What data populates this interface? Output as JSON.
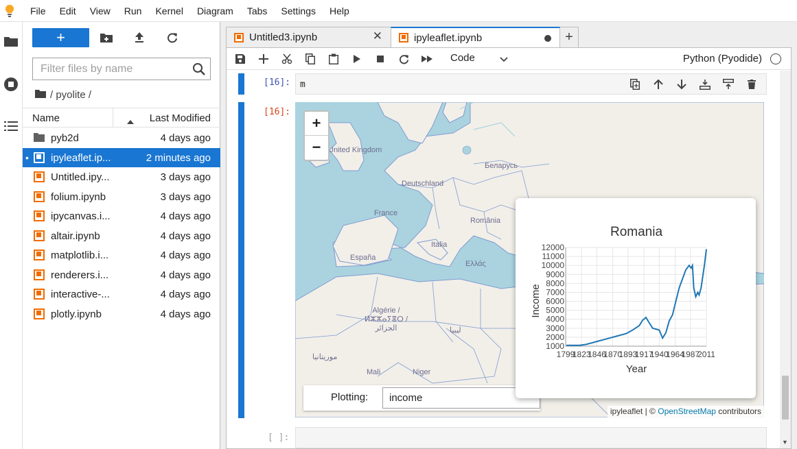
{
  "menu": [
    "File",
    "Edit",
    "View",
    "Run",
    "Kernel",
    "Diagram",
    "Tabs",
    "Settings",
    "Help"
  ],
  "filebrowser": {
    "new_label": "+",
    "filter_placeholder": "Filter files by name",
    "breadcrumb": "/ pyolite /",
    "col_name": "Name",
    "col_modified": "Last Modified",
    "files": [
      {
        "name": "pyb2d",
        "modified": "4 days ago",
        "type": "folder"
      },
      {
        "name": "ipyleaflet.ip...",
        "modified": "2 minutes ago",
        "type": "notebook",
        "selected": true
      },
      {
        "name": "Untitled.ipy...",
        "modified": "3 days ago",
        "type": "notebook"
      },
      {
        "name": "folium.ipynb",
        "modified": "3 days ago",
        "type": "notebook"
      },
      {
        "name": "ipycanvas.i...",
        "modified": "4 days ago",
        "type": "notebook"
      },
      {
        "name": "altair.ipynb",
        "modified": "4 days ago",
        "type": "notebook"
      },
      {
        "name": "matplotlib.i...",
        "modified": "4 days ago",
        "type": "notebook"
      },
      {
        "name": "renderers.i...",
        "modified": "4 days ago",
        "type": "notebook"
      },
      {
        "name": "interactive-...",
        "modified": "4 days ago",
        "type": "notebook"
      },
      {
        "name": "plotly.ipynb",
        "modified": "4 days ago",
        "type": "notebook"
      }
    ]
  },
  "tabs": [
    {
      "label": "Untitled3.ipynb",
      "active": false
    },
    {
      "label": "ipyleaflet.ipynb",
      "active": true
    }
  ],
  "notebook": {
    "cell_type": "Code",
    "kernel": "Python (Pyodide)",
    "in_prompt": "[16]:",
    "out_prompt": "[16]:",
    "empty_prompt": "[ ]:",
    "code": "m"
  },
  "map": {
    "zoom_in": "+",
    "zoom_out": "−",
    "labels": {
      "uk": "United Kingdom",
      "de": "Deutschland",
      "fr": "France",
      "es": "España",
      "it": "Italia",
      "ro": "România",
      "gr": "Ελλάς",
      "by": "Беларусь",
      "dz": "Algérie / ⵍⵣⵣⴰⵢⴻⵔ / الجزائر",
      "ly": "ليبيا",
      "ml": "Mali",
      "ne": "Niger",
      "mr": "موريتانيا"
    },
    "attribution_prefix": "ipyleaflet | ©",
    "attribution_link": "OpenStreetMap",
    "attribution_suffix": "contributors",
    "plot_label": "Plotting:",
    "plot_value": "income"
  },
  "chart_data": {
    "type": "line",
    "title": "Romania",
    "xlabel": "Year",
    "ylabel": "Income",
    "xlim": [
      1799,
      2011
    ],
    "ylim": [
      1000,
      12000
    ],
    "xticks": [
      1799,
      1823,
      1846,
      1870,
      1893,
      1917,
      1940,
      1964,
      1987,
      2011
    ],
    "yticks": [
      1000,
      2000,
      3000,
      4000,
      5000,
      6000,
      7000,
      8000,
      9000,
      10000,
      11000,
      12000
    ],
    "x": [
      1800,
      1820,
      1830,
      1850,
      1870,
      1890,
      1900,
      1910,
      1915,
      1920,
      1925,
      1930,
      1935,
      1940,
      1945,
      1950,
      1955,
      1960,
      1965,
      1970,
      1975,
      1980,
      1985,
      1988,
      1990,
      1992,
      1995,
      1998,
      2000,
      2003,
      2005,
      2008,
      2011
    ],
    "y": [
      1100,
      1100,
      1200,
      1600,
      2000,
      2400,
      2800,
      3300,
      3900,
      4200,
      3600,
      3000,
      2900,
      2800,
      1900,
      2500,
      3800,
      4500,
      6000,
      7500,
      8500,
      9500,
      10000,
      9700,
      10000,
      7500,
      6500,
      7000,
      6700,
      7500,
      8500,
      10000,
      11800
    ],
    "color": "#1f77b4"
  }
}
